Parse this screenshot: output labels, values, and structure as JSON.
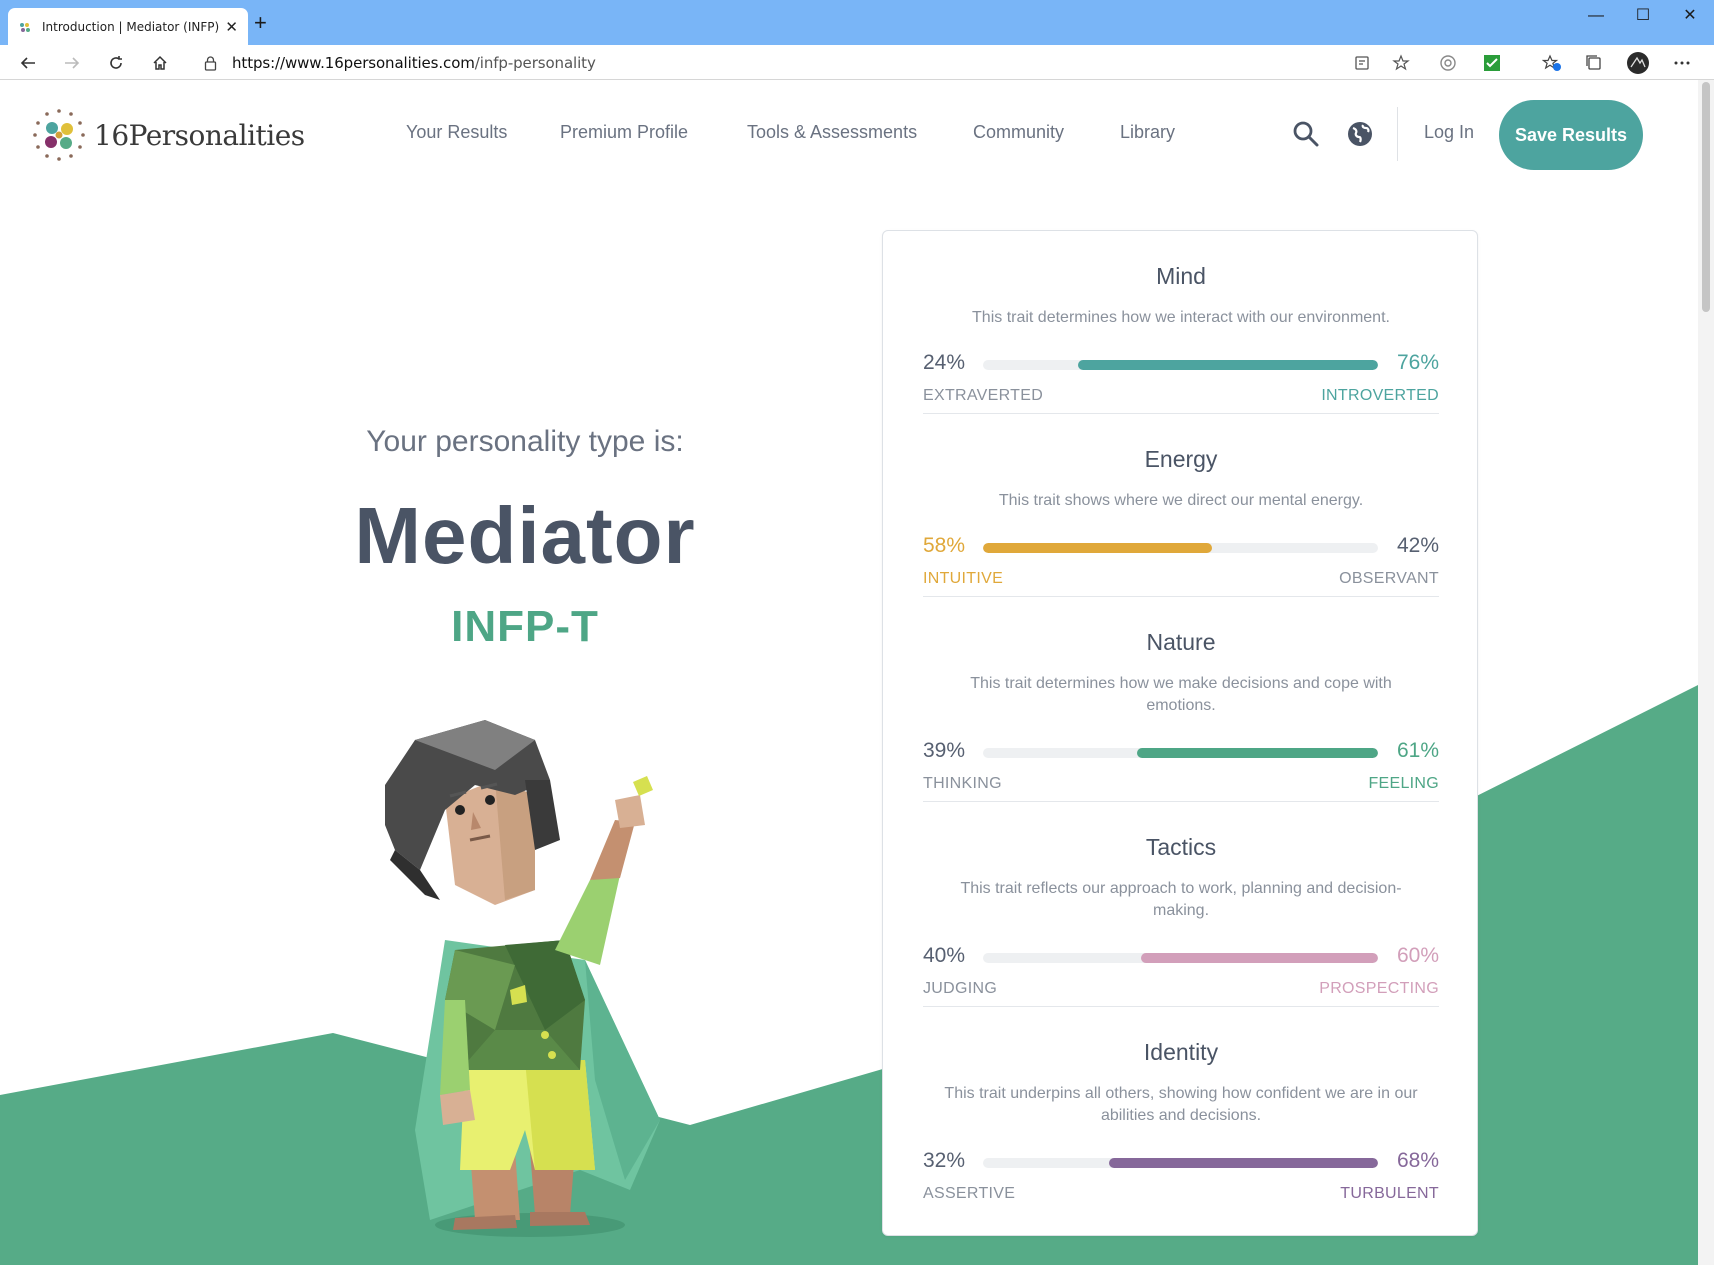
{
  "browser": {
    "tab_title": "Introduction | Mediator (INFP) Pe",
    "url_host": "https://www.16personalities.com",
    "url_path": "/infp-personality",
    "window_controls": [
      "—",
      "☐",
      "✕"
    ]
  },
  "nav": {
    "logo_text": "16Personalities",
    "links": [
      "Your Results",
      "Premium Profile",
      "Tools & Assessments",
      "Community",
      "Library"
    ],
    "login_label": "Log In",
    "save_label": "Save Results"
  },
  "hero": {
    "subtitle": "Your personality type is:",
    "type_name": "Mediator",
    "type_code": "INFP-T"
  },
  "colors": {
    "teal": "#4da49f",
    "mind": "#4da49f",
    "energy": "#e0a83a",
    "nature": "#4ea686",
    "tactics": "#d29fba",
    "identity": "#86689a",
    "hill": "#56ab87"
  },
  "traits": [
    {
      "title": "Mind",
      "description": "This trait determines how we interact with our environment.",
      "left_pct": "24%",
      "right_pct": "76%",
      "left_label": "EXTRAVERTED",
      "right_label": "INTROVERTED",
      "dominant": "right",
      "fill_fraction": 0.76,
      "color": "#4da49f"
    },
    {
      "title": "Energy",
      "description": "This trait shows where we direct our mental energy.",
      "left_pct": "58%",
      "right_pct": "42%",
      "left_label": "INTUITIVE",
      "right_label": "OBSERVANT",
      "dominant": "left",
      "fill_fraction": 0.58,
      "color": "#e0a83a"
    },
    {
      "title": "Nature",
      "description": "This trait determines how we make decisions and cope with emotions.",
      "left_pct": "39%",
      "right_pct": "61%",
      "left_label": "THINKING",
      "right_label": "FEELING",
      "dominant": "right",
      "fill_fraction": 0.61,
      "color": "#4ea686"
    },
    {
      "title": "Tactics",
      "description": "This trait reflects our approach to work, planning and decision-making.",
      "left_pct": "40%",
      "right_pct": "60%",
      "left_label": "JUDGING",
      "right_label": "PROSPECTING",
      "dominant": "right",
      "fill_fraction": 0.6,
      "color": "#d29fba"
    },
    {
      "title": "Identity",
      "description": "This trait underpins all others, showing how confident we are in our abilities and decisions.",
      "left_pct": "32%",
      "right_pct": "68%",
      "left_label": "ASSERTIVE",
      "right_label": "TURBULENT",
      "dominant": "right",
      "fill_fraction": 0.68,
      "color": "#86689a"
    }
  ]
}
